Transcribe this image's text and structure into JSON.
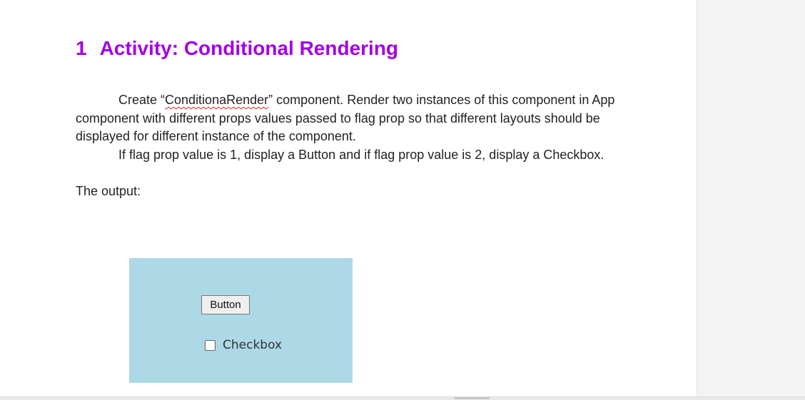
{
  "heading": {
    "number": "1",
    "title": "Activity: Conditional Rendering"
  },
  "body": {
    "para1_before": "Create “",
    "para1_component": "ConditionaRender",
    "para1_after": "” component. Render two instances of this component in App component with different props values passed to flag prop so that different layouts should be displayed for different instance of the component.",
    "para2": "If flag prop value is 1, display a Button and if flag prop value is 2, display a Checkbox.",
    "output_label": "The output:"
  },
  "output_demo": {
    "background": "#add8e6",
    "button_label": "Button",
    "checkbox_label": "Checkbox",
    "checkbox_checked": false
  },
  "colors": {
    "heading": "#a200e6",
    "text": "#222222"
  }
}
